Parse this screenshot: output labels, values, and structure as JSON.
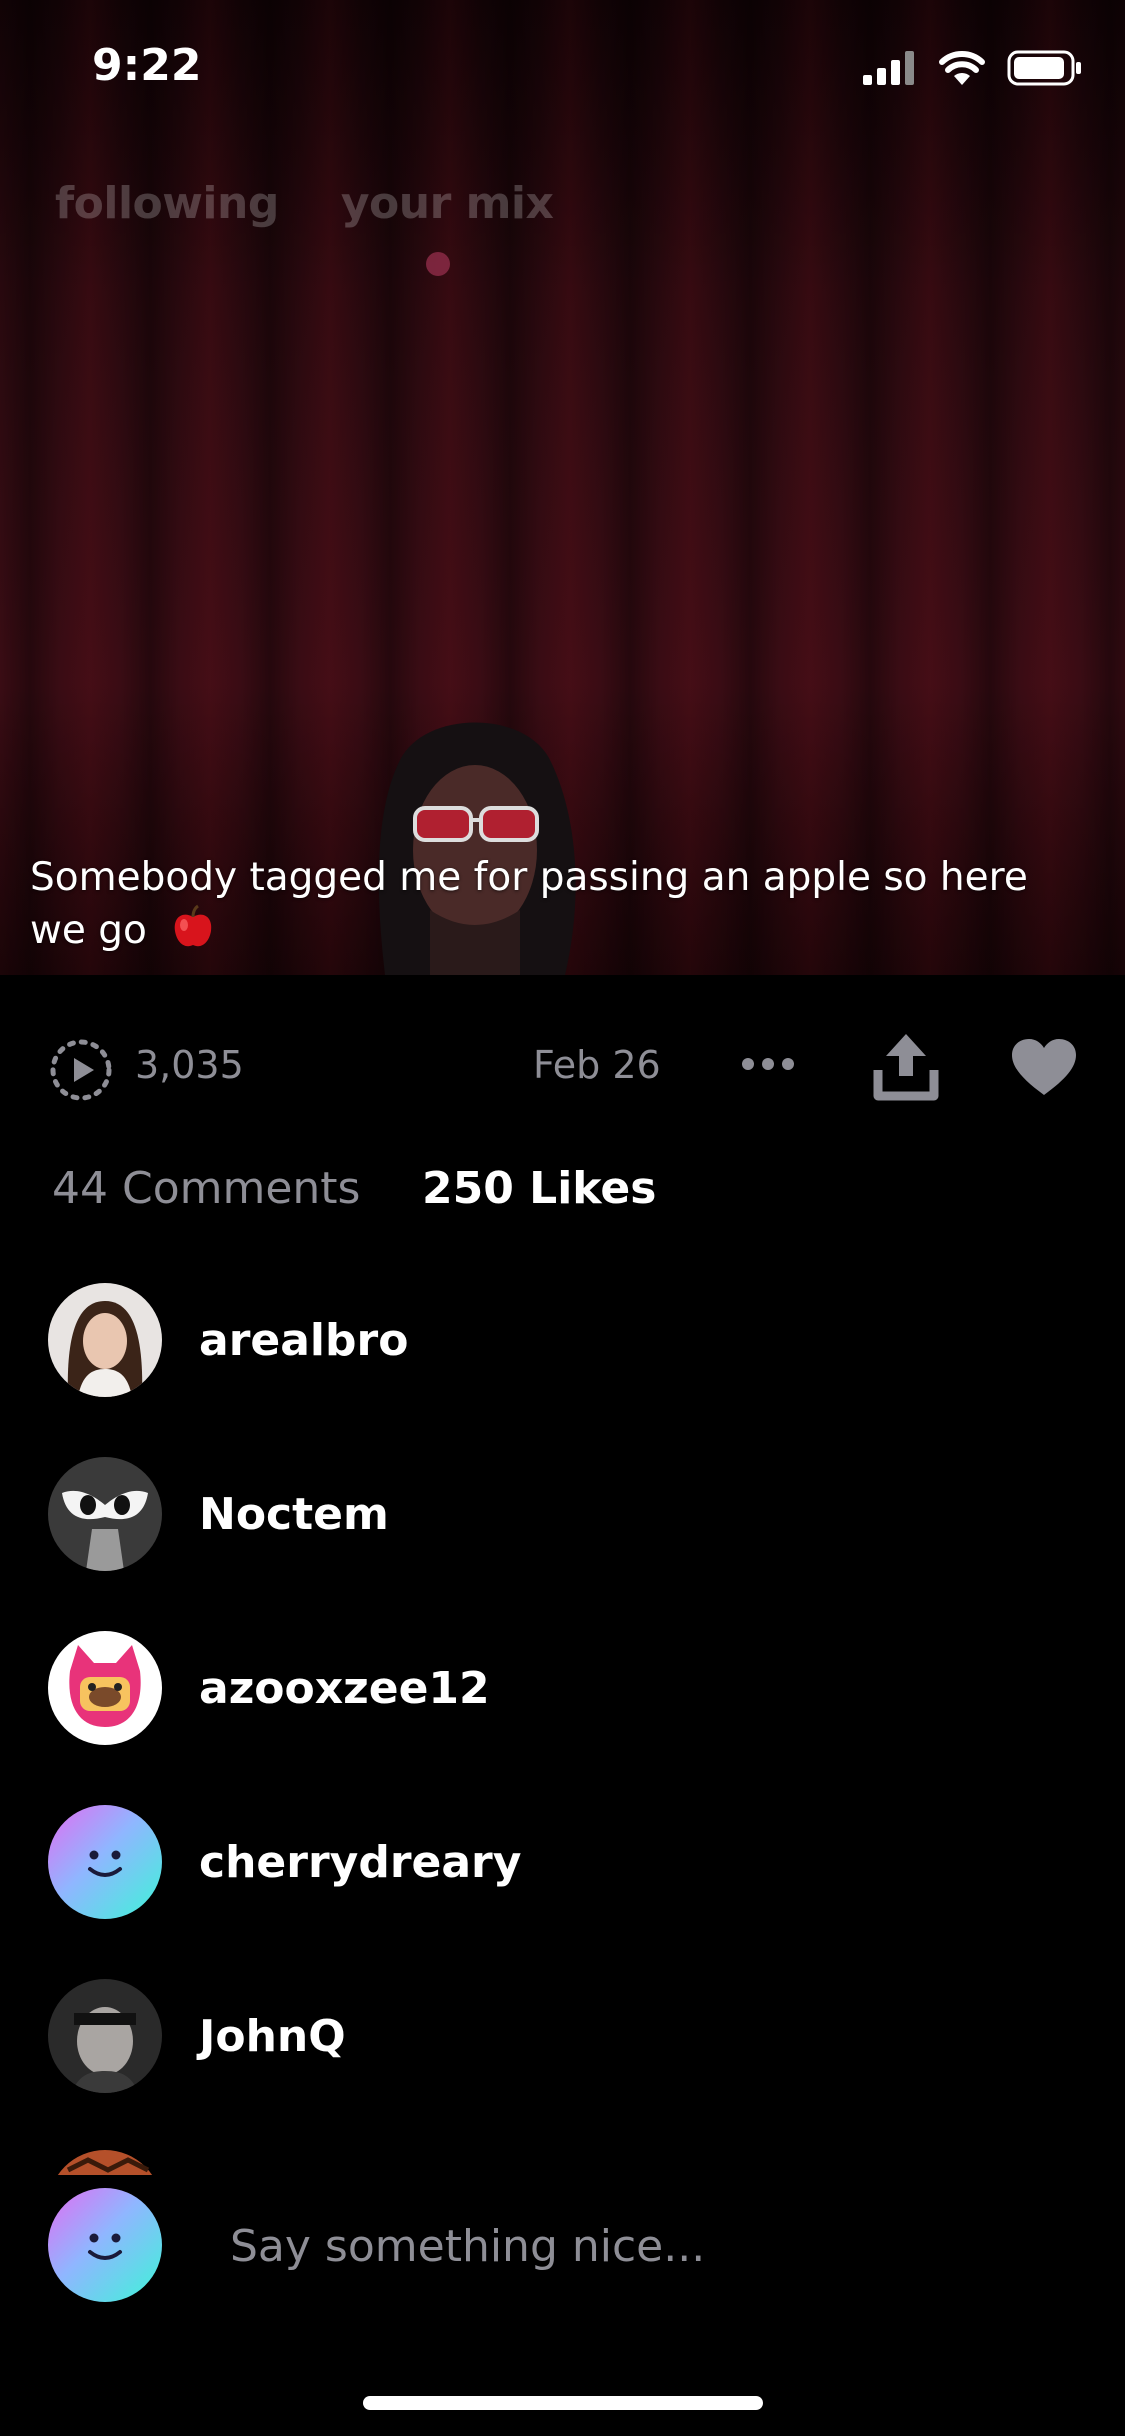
{
  "status_bar": {
    "time": "9:22"
  },
  "feed_tabs": {
    "following": "following",
    "your_mix": "your mix"
  },
  "video": {
    "caption": "Somebody tagged me for passing an apple so here we go"
  },
  "stats": {
    "plays": "3,035",
    "date": "Feb 26"
  },
  "tabs": {
    "comments": "44 Comments",
    "likes": "250 Likes"
  },
  "likes": [
    {
      "username": "arealbro",
      "avatar": "photo-avatar"
    },
    {
      "username": "Noctem",
      "avatar": "mask-avatar"
    },
    {
      "username": "azooxzee12",
      "avatar": "bear-avatar"
    },
    {
      "username": "cherrydreary",
      "avatar": "smiley-gradient-avatar"
    },
    {
      "username": "JohnQ",
      "avatar": "photo-avatar"
    }
  ],
  "composer": {
    "placeholder": "Say something nice..."
  },
  "colors": {
    "background": "#000000",
    "muted_text": "#8e8e96",
    "accent_dot": "#8a2a45"
  }
}
